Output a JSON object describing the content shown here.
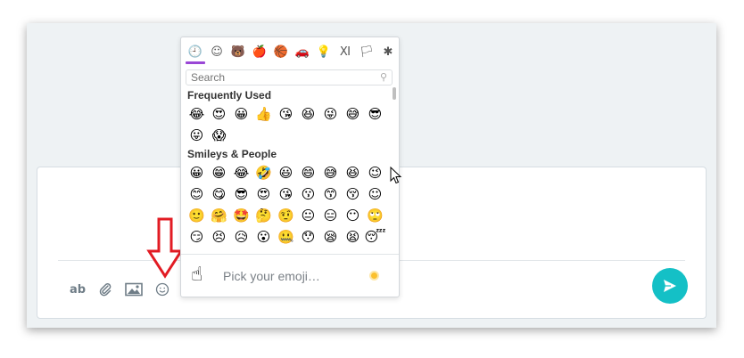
{
  "toolbar": {
    "format_label": "ab",
    "attach_icon": "paperclip-icon",
    "image_icon": "image-icon",
    "emoji_icon": "smiley-icon"
  },
  "send_icon": "send-icon",
  "picker": {
    "categories": [
      "🕘",
      "☺",
      "🐻",
      "🍎",
      "🏀",
      "🚗",
      "💡",
      "Ⅺ",
      "🏳",
      "✱"
    ],
    "search_placeholder": "Search",
    "sections": [
      {
        "title": "Frequently Used",
        "emojis": [
          "😂",
          "😍",
          "😀",
          "👍",
          "😘",
          "😆",
          "😜",
          "😅",
          "😎",
          "😛",
          "😱"
        ]
      },
      {
        "title": "Smileys & People",
        "emojis": [
          "😀",
          "😁",
          "😂",
          "🤣",
          "😃",
          "😄",
          "😅",
          "😆",
          "😉",
          "😊",
          "😋",
          "😎",
          "😍",
          "😘",
          "😗",
          "😙",
          "😚",
          "☺",
          "🙂",
          "🤗",
          "🤩",
          "🤔",
          "🤨",
          "😐",
          "😑",
          "😶",
          "🙄",
          "😏",
          "😣",
          "😥",
          "😮",
          "🤐",
          "😯",
          "😪",
          "😫",
          "😴"
        ]
      }
    ],
    "footer_emoji": "☝",
    "footer_hint": "Pick your emoji…"
  },
  "colors": {
    "accent": "#9a47d6",
    "send": "#14c0c6",
    "arrow": "#e21b23"
  }
}
